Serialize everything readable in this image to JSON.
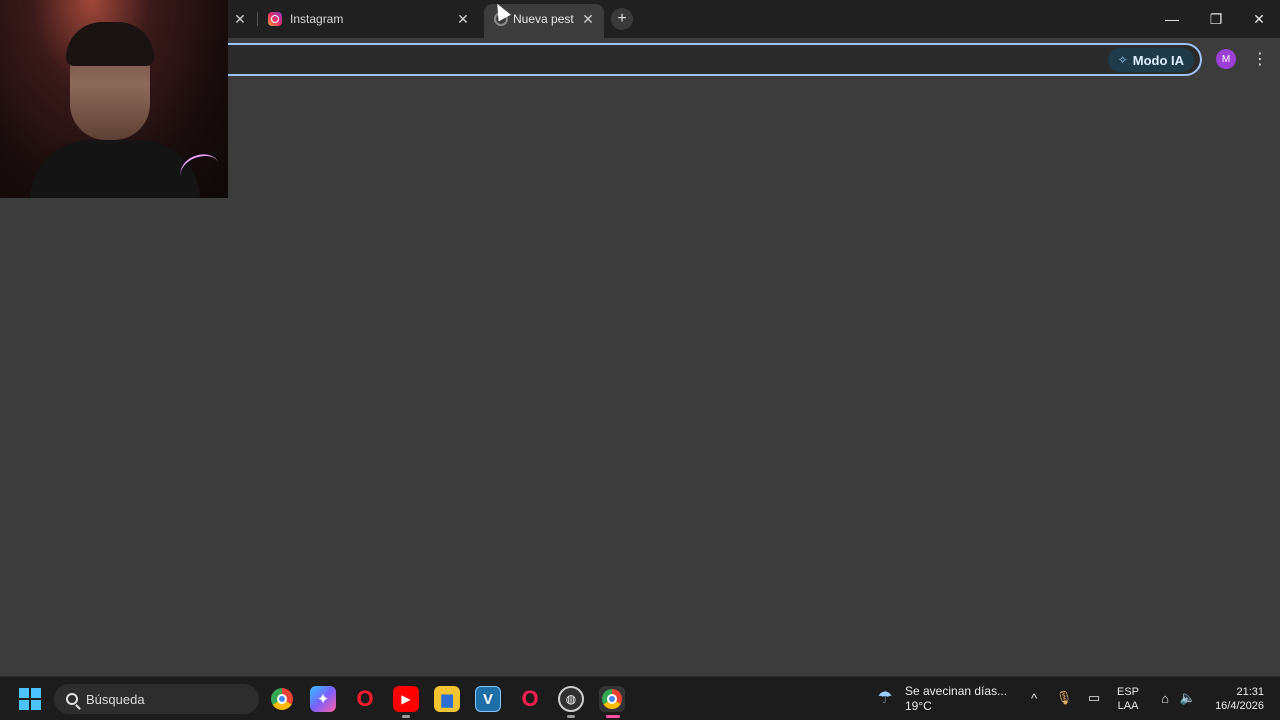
{
  "tabs": [
    {
      "title": "Instagram",
      "icon": "instagram-icon",
      "active": false
    },
    {
      "title": "Nueva pest",
      "icon": "new-tab-icon",
      "active": true
    }
  ],
  "window_controls": {
    "minimize": "—",
    "restore": "❐",
    "close": "✕"
  },
  "toolbar": {
    "omnibox_value": "",
    "ai_mode_label": "Modo IA",
    "profile_initial": "M",
    "menu_glyph": "⋮"
  },
  "taskbar": {
    "search_placeholder": "Búsqueda",
    "weather": {
      "summary": "Se avecinan días...",
      "temp": "19°C"
    },
    "language": {
      "line1": "ESP",
      "line2": "LAA"
    },
    "time": "21:31",
    "date": "16/4/2026",
    "apps": [
      {
        "name": "chrome-icon",
        "glyph": "◉",
        "color": "#34a853"
      },
      {
        "name": "copilot-icon",
        "glyph": "✦",
        "color": "#7b61ff"
      },
      {
        "name": "opera-icon",
        "glyph": "O",
        "color": "#ff1b2d"
      },
      {
        "name": "youtube-icon",
        "glyph": "▶",
        "color": "#ff0000"
      },
      {
        "name": "file-explorer-icon",
        "glyph": "▆",
        "color": "#f4c430"
      },
      {
        "name": "vegas-icon",
        "glyph": "V",
        "color": "#1e90c8"
      },
      {
        "name": "opera-gx-icon",
        "glyph": "O",
        "color": "#fa1e4e"
      },
      {
        "name": "obs-icon",
        "glyph": "◍",
        "color": "#3a3a3a"
      },
      {
        "name": "chrome-profile-icon",
        "glyph": "◉",
        "color": "#34a853"
      }
    ]
  },
  "colors": {
    "accent": "#9ec3ff",
    "tab_strip": "#202020",
    "content": "#3c3c3c"
  }
}
